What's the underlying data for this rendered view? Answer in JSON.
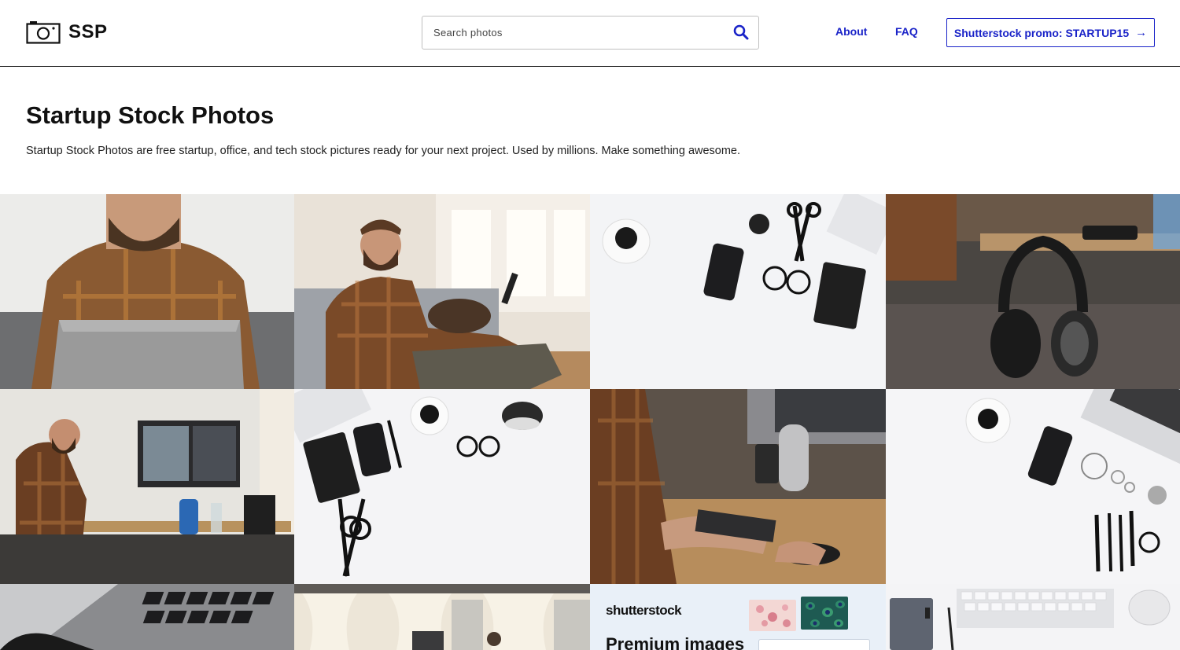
{
  "header": {
    "logo_text": "SSP",
    "search_placeholder": "Search photos",
    "nav": {
      "about": "About",
      "faq": "FAQ"
    },
    "promo_label": "Shutterstock promo: STARTUP15",
    "promo_arrow": "→"
  },
  "intro": {
    "title": "Startup Stock Photos",
    "description": "Startup Stock Photos are free startup, office, and tech stock pictures ready for your next project. Used by millions. Make something awesome."
  },
  "ad": {
    "brand": "shutterstock",
    "headline": "Premium images"
  },
  "theme": {
    "accent": "#1a23c8",
    "text": "#111111",
    "border": "#bfbfbf"
  }
}
